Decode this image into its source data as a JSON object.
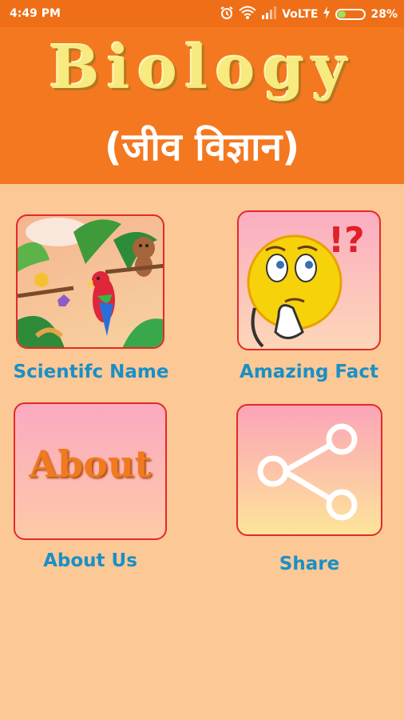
{
  "status_bar": {
    "time": "4:49 PM",
    "network": "VoLTE",
    "battery": "28%",
    "battery_level": 0.28,
    "icons": [
      "alarm-icon",
      "wifi-icon",
      "signal-icon",
      "charging-icon",
      "battery-icon"
    ]
  },
  "header": {
    "title": "Biology",
    "subtitle": "(जीव विज्ञान)"
  },
  "tiles": [
    {
      "name": "scientific-name",
      "label": "Scientifc Name",
      "icon": "jungle-parrot-image"
    },
    {
      "name": "amazing-fact",
      "label": "Amazing Fact",
      "icon": "thinking-emoji-icon"
    },
    {
      "name": "about-us",
      "label": "About Us",
      "icon_text": "About"
    },
    {
      "name": "share",
      "label": "Share",
      "icon": "share-icon"
    }
  ],
  "colors": {
    "status_bar": "#ee6f17",
    "header": "#f47820",
    "background": "#fcc896",
    "label": "#1a8fc6",
    "tile_border": "#e22a2a"
  }
}
